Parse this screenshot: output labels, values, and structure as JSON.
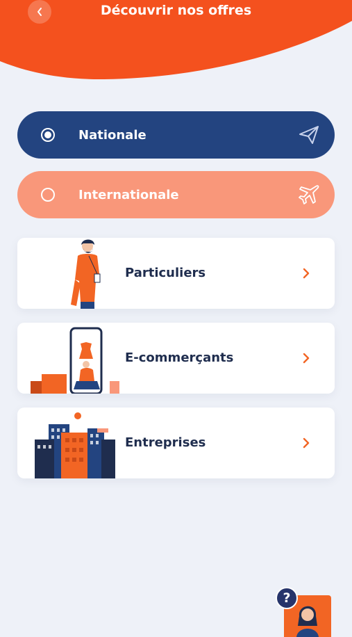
{
  "header": {
    "title": "Découvrir nos offres",
    "back_icon": "chevron-left-icon"
  },
  "scope_options": [
    {
      "label": "Nationale",
      "selected": true,
      "icon": "paper-plane-icon",
      "color": "#234480"
    },
    {
      "label": "Internationale",
      "selected": false,
      "icon": "airplane-icon",
      "color": "#f9977a"
    }
  ],
  "offers": [
    {
      "label": "Particuliers",
      "icon": "chevron-right-icon"
    },
    {
      "label": "E-commerçants",
      "icon": "chevron-right-icon"
    },
    {
      "label": "Entreprises",
      "icon": "chevron-right-icon"
    }
  ],
  "help": {
    "symbol": "?"
  },
  "colors": {
    "accent": "#f26524",
    "primary": "#234480",
    "background": "#eef1f8"
  }
}
